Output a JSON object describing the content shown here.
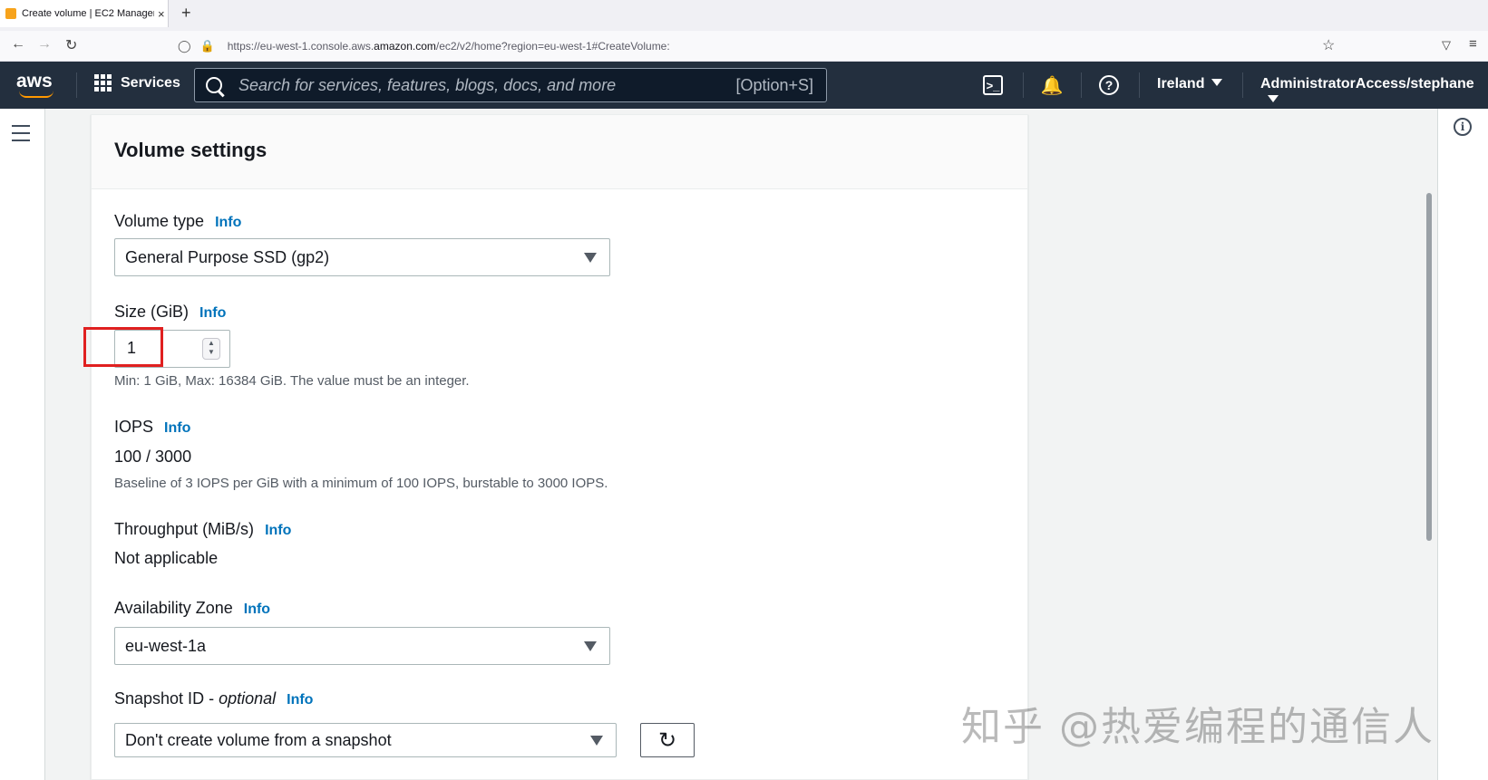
{
  "browser": {
    "tab_title": "Create volume | EC2 Manageme",
    "tab_close": "×",
    "new_tab": "+",
    "url_prefix": "https://eu-west-1.console.aws.",
    "url_domain": "amazon.com",
    "url_suffix": "/ec2/v2/home?region=eu-west-1#CreateVolume:"
  },
  "awsnav": {
    "logo": "aws",
    "services_label": "Services",
    "search_placeholder": "Search for services, features, blogs, docs, and more",
    "search_shortcut": "[Option+S]",
    "cloudshell_glyph": ">_",
    "help_glyph": "?",
    "region_label": "Ireland",
    "account_label": "AdministratorAccess/stephane"
  },
  "panel": {
    "title": "Volume settings"
  },
  "fields": {
    "info_link": "Info",
    "volume_type": {
      "label": "Volume type",
      "value": "General Purpose SSD (gp2)"
    },
    "size": {
      "label": "Size (GiB)",
      "value": "1",
      "hint": "Min: 1 GiB, Max: 16384 GiB. The value must be an integer."
    },
    "iops": {
      "label": "IOPS",
      "value": "100 / 3000",
      "hint": "Baseline of 3 IOPS per GiB with a minimum of 100 IOPS, burstable to 3000 IOPS."
    },
    "throughput": {
      "label": "Throughput (MiB/s)",
      "value": "Not applicable"
    },
    "availability_zone": {
      "label": "Availability Zone",
      "value": "eu-west-1a"
    },
    "snapshot": {
      "label": "Snapshot ID - ",
      "label_optional": "optional",
      "value": "Don't create volume from a snapshot"
    }
  },
  "watermark": "知乎 @热爱编程的通信人",
  "colors": {
    "aws_nav": "#232f3e",
    "aws_orange": "#ff9900",
    "info_link": "#0073bb",
    "highlight_box": "#e02020"
  }
}
